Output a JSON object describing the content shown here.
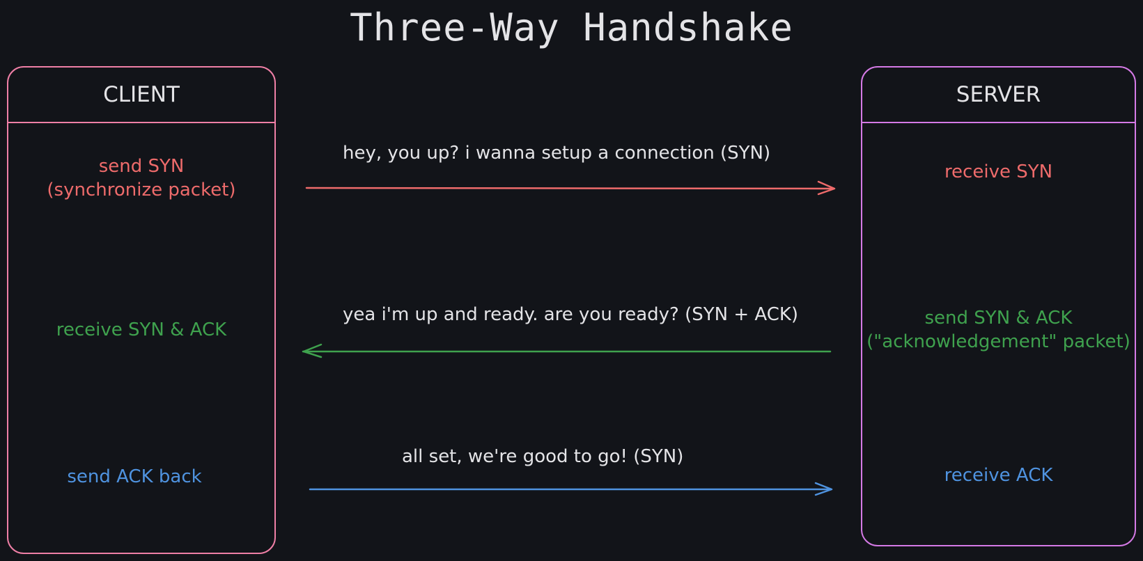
{
  "title": "Three-Way Handshake",
  "colors": {
    "background": "#121419",
    "text": "#e4e4e7",
    "client_border": "#ef7fa6",
    "server_border": "#d57ae6",
    "syn": "#ee6b6b",
    "synack": "#3fa24e",
    "ack": "#4f93e0"
  },
  "client": {
    "label": "CLIENT",
    "steps": [
      {
        "line1": "send SYN",
        "line2": "(synchronize packet)"
      },
      {
        "line1": "receive SYN & ACK"
      },
      {
        "line1": "send ACK back"
      }
    ]
  },
  "server": {
    "label": "SERVER",
    "steps": [
      {
        "line1": "receive SYN"
      },
      {
        "line1": "send SYN & ACK",
        "line2": "(\"acknowledgement\" packet)"
      },
      {
        "line1": "receive ACK"
      }
    ]
  },
  "messages": [
    {
      "label": "hey, you up? i wanna setup a connection (SYN)",
      "direction": "client-to-server"
    },
    {
      "label": "yea i'm up and ready. are you ready? (SYN + ACK)",
      "direction": "server-to-client"
    },
    {
      "label": "all set, we're good to go! (SYN)",
      "direction": "client-to-server"
    }
  ]
}
